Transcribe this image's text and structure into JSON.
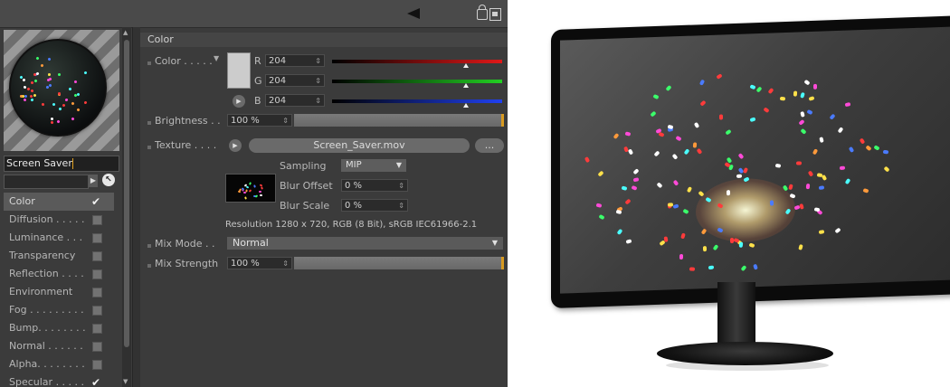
{
  "toolbar": {
    "back_icon": "back-arrow-icon",
    "lock_icon": "lock-icon",
    "window_icon": "window-icon"
  },
  "material": {
    "name": "Screen Saver"
  },
  "channels": [
    {
      "label": "Color",
      "active": true,
      "checked": true
    },
    {
      "label": "Diffusion . . . . .",
      "checked": false
    },
    {
      "label": "Luminance . . .",
      "checked": false
    },
    {
      "label": "Transparency",
      "checked": false
    },
    {
      "label": "Reflection . . . .",
      "checked": false
    },
    {
      "label": "Environment",
      "checked": false
    },
    {
      "label": "Fog . . . . . . . . .",
      "checked": false
    },
    {
      "label": "Bump. . . . . . . .",
      "checked": false
    },
    {
      "label": "Normal . . . . . .",
      "checked": false
    },
    {
      "label": "Alpha. . . . . . . .",
      "checked": false
    },
    {
      "label": "Specular . . . . .",
      "checked": true
    }
  ],
  "color_section": {
    "title": "Color",
    "color_label": "Color . . . . .",
    "swatch_color": "#cccccc",
    "r_label": "R",
    "r_value": "204",
    "g_label": "G",
    "g_value": "204",
    "b_label": "B",
    "b_value": "204",
    "brightness_label": "Brightness . .",
    "brightness_value": "100 %",
    "texture_label": "Texture . . . .",
    "texture_file": "Screen_Saver.mov",
    "texture_more": "...",
    "sampling_label": "Sampling",
    "sampling_value": "MIP",
    "blur_offset_label": "Blur Offset",
    "blur_offset_value": "0 %",
    "blur_scale_label": "Blur Scale",
    "blur_scale_value": "0 %",
    "resolution_info": "Resolution 1280 x 720, RGB (8 Bit), sRGB IEC61966-2.1",
    "mix_mode_label": "Mix Mode . .",
    "mix_mode_value": "Normal",
    "mix_strength_label": "Mix Strength",
    "mix_strength_value": "100 %"
  },
  "colors": {
    "panel_bg": "#3b3b3b",
    "accent": "#d89a20",
    "red": "#e01818",
    "green": "#22d022",
    "blue": "#2040f0"
  }
}
